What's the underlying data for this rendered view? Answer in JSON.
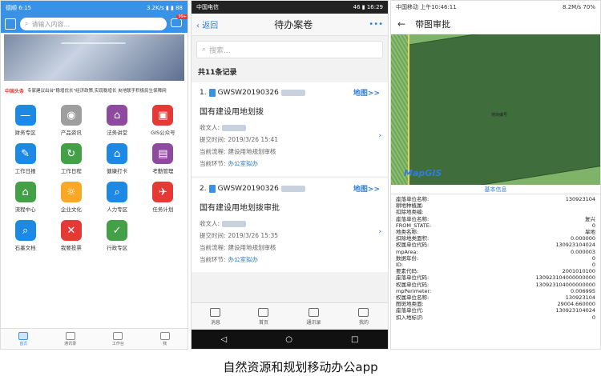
{
  "phone1": {
    "status_left": "德顺 6:15",
    "status_right": "3.2K/s ▮ ▮ 88",
    "search_placeholder": "请输入内容...",
    "badge": "99+",
    "news_tag": "中国头条",
    "news_text": "专家建议出台\"稳增优长\"经济政策,实现稳增长 央地联手积极民生保障网",
    "grid": [
      {
        "label": "财务专区",
        "color": "#1e88e5",
        "icon": "—"
      },
      {
        "label": "产品资讯",
        "color": "#9e9e9e",
        "icon": "◉"
      },
      {
        "label": "法务讲堂",
        "color": "#8e4a9e",
        "icon": "⌂"
      },
      {
        "label": "GIS公众号",
        "color": "#e53935",
        "icon": "▣"
      },
      {
        "label": "工作日报",
        "color": "#1e88e5",
        "icon": "✎"
      },
      {
        "label": "工作日程",
        "color": "#43a047",
        "icon": "↻"
      },
      {
        "label": "健康打卡",
        "color": "#1e88e5",
        "icon": "⌂"
      },
      {
        "label": "考勤管理",
        "color": "#8e4a9e",
        "icon": "▤"
      },
      {
        "label": "流程中心",
        "color": "#43a047",
        "icon": "⌂"
      },
      {
        "label": "企业文化",
        "color": "#f9a825",
        "icon": "☼"
      },
      {
        "label": "人力专区",
        "color": "#1e88e5",
        "icon": "⌕"
      },
      {
        "label": "任务计划",
        "color": "#e53935",
        "icon": "✈"
      },
      {
        "label": "石墨文档",
        "color": "#1e88e5",
        "icon": "⌕"
      },
      {
        "label": "我要投票",
        "color": "#e53935",
        "icon": "✕"
      },
      {
        "label": "行政专区",
        "color": "#43a047",
        "icon": "✓"
      }
    ],
    "tabs": [
      "首页",
      "通讯录",
      "工作台",
      "我"
    ]
  },
  "phone2": {
    "status_left": "中国电信",
    "status_right": "46 ▮ 16:29",
    "back": "返回",
    "title": "待办案卷",
    "more": "•••",
    "search_placeholder": "搜索...",
    "count": "共11条记录",
    "cards": [
      {
        "num": "1.",
        "id": "GWSW20190326",
        "map": "地图>>",
        "title": "国有建设用地划拨",
        "receiver_label": "收文人:",
        "submit_label": "提交时间:",
        "submit": "2019/3/26 15:41",
        "flow_label": "当前流程:",
        "flow": "建设用地规划审核",
        "step_label": "当前环节:",
        "step": "办公室拟办"
      },
      {
        "num": "2.",
        "id": "GWSW20190326",
        "map": "地图>>",
        "title": "国有建设用地划拨审批",
        "receiver_label": "收文人:",
        "submit_label": "提交时间:",
        "submit": "2019/3/26 15:35",
        "flow_label": "当前流程:",
        "flow": "建设用地规划审核",
        "step_label": "当前环节:",
        "step": "办公室拟办"
      }
    ],
    "tabs": [
      "消息",
      "首页",
      "通讯录",
      "我的"
    ]
  },
  "phone3": {
    "status_left": "中国移动 上午10:46:11",
    "status_right": "8.2M/s 70%",
    "title": "带图审批",
    "parcel_label": "地块编号",
    "map_logo": "MapGIS",
    "info_title": "基本信息",
    "rows": [
      [
        "座落单位名称:",
        "130923104"
      ],
      [
        "耕地种植属:",
        ""
      ],
      [
        "扣除地类编:",
        ""
      ],
      [
        "座落单位名称:",
        "复兴"
      ],
      [
        "FROM_STATE:",
        "0"
      ],
      [
        "地类名称:",
        "旱地"
      ],
      [
        "扣除地类面积:",
        "0.000000"
      ],
      [
        "权属单位代码:",
        "130923104024"
      ],
      [
        "mpArea:",
        "0.000003"
      ],
      [
        "数据年份:",
        "0"
      ],
      [
        "ID:",
        "0"
      ],
      [
        "要素代码:",
        "2001010100"
      ],
      [
        "座落单位代码:",
        "130923104000000000"
      ],
      [
        "权属单位代码:",
        "130923104000000000"
      ],
      [
        "mpPerimeter:",
        "0.006995"
      ],
      [
        "权属单位名称:",
        "130923104"
      ],
      [
        "图斑地类面:",
        "29004.660000"
      ],
      [
        "座落单位代:",
        "130923104024"
      ],
      [
        "扣入地标识:",
        "0"
      ]
    ]
  },
  "caption": "自然资源和规划移动办公app"
}
